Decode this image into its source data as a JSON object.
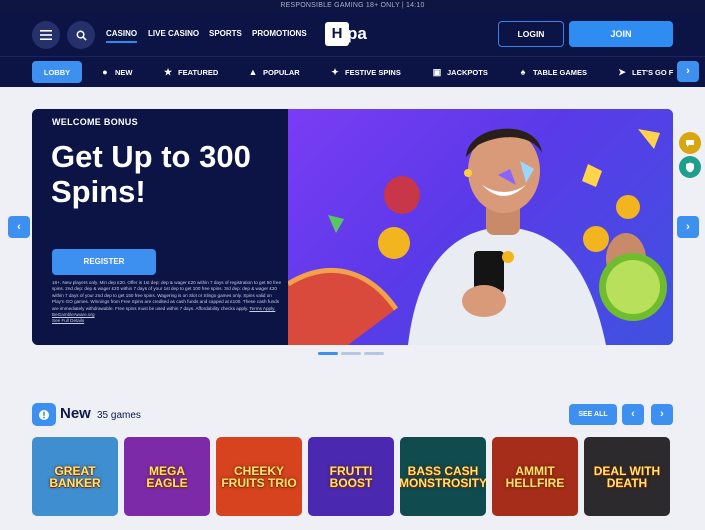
{
  "topbar": {
    "text": "RESPONSIBLE GAMING 18+ ONLY | 14:10"
  },
  "header": {
    "nav": [
      "CASINO",
      "LIVE CASINO",
      "SPORTS",
      "PROMOTIONS"
    ],
    "logo": {
      "box": "H",
      "rest": "pa"
    },
    "login": "LOGIN",
    "join": "JOIN"
  },
  "categories": [
    "LOBBY",
    "NEW",
    "FEATURED",
    "POPULAR",
    "FESTIVE SPINS",
    "JACKPOTS",
    "TABLE GAMES",
    "LET'S GO F"
  ],
  "banner": {
    "eyebrow": "WELCOME BONUS",
    "headline": "Get Up to 300 Spins!",
    "cta": "REGISTER",
    "terms": "18+. New players only. Min dep £20. Offer is 1st dep: dep & wager £20 within 7 days of registration to get 50 free spins. 2nd dep: dep & wager £20 within 7 days of your 1st dep to get 100 free spins. 3rd dep: dep & wager £20 within 7 days of your 2nd dep to get 150 free spins. Wagering is on Slot or Slingo games only. Spins valid on Play'n GO games. Winnings from Free Spins are credited as cash funds and capped at £100. These cash funds are immediately withdrawable. Free spins must be used within 7 days. Affordability checks apply.",
    "terms_apply": "Terms Apply.",
    "terms_link": "BeGambleAware.org",
    "full_details": "See Full Details"
  },
  "section": {
    "title": "New",
    "count": "35 games",
    "see_all": "SEE ALL",
    "games": [
      {
        "name": "GREAT BANKER",
        "bg": "#3f8fd0"
      },
      {
        "name": "MEGA EAGLE",
        "bg": "#7d2aa8"
      },
      {
        "name": "CHEEKY FRUITS TRIO",
        "bg": "#d6431e"
      },
      {
        "name": "FRUTTI BOOST",
        "bg": "#4a28b0"
      },
      {
        "name": "BASS CASH MONSTROSITY",
        "bg": "#0f4b4f"
      },
      {
        "name": "AMMIT HELLFIRE",
        "bg": "#a52d1a"
      },
      {
        "name": "DEAL WITH DEATH",
        "bg": "#2c2a2c"
      }
    ]
  },
  "colors": {
    "navy": "#0b1445",
    "accent": "#3d8ff0",
    "banner_purple": "#6a3cf0",
    "chat": "#d9a60f",
    "shield": "#1e9f8c"
  }
}
